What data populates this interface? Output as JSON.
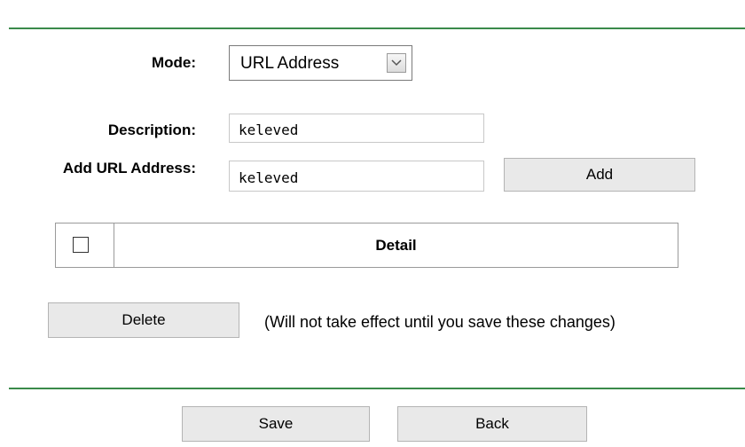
{
  "mode": {
    "label": "Mode:",
    "value": "URL Address"
  },
  "description": {
    "label": "Description:",
    "value": "keleved"
  },
  "add_url": {
    "label": "Add URL Address:",
    "value": "keleved",
    "button": "Add"
  },
  "table": {
    "header": "Detail"
  },
  "delete": {
    "button": "Delete",
    "note": "(Will not take effect until you save these changes)"
  },
  "footer": {
    "save": "Save",
    "back": "Back"
  },
  "colors": {
    "divider": "#3a8a4a",
    "button_bg": "#e9e9e9"
  }
}
